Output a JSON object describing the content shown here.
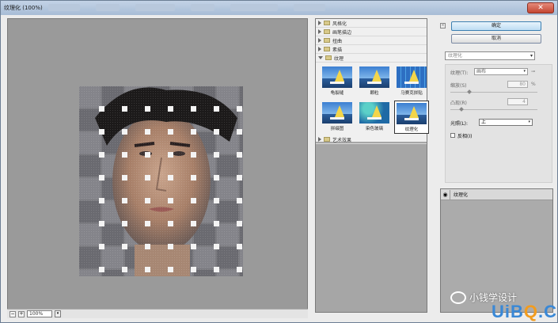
{
  "window": {
    "title": "纹理化 (100%)",
    "close_glyph": "✕"
  },
  "preview": {
    "zoom": "100%"
  },
  "gallery": {
    "folders_top": [
      "风格化",
      "画笔描边",
      "扭曲",
      "素描"
    ],
    "open_folder": "纹理",
    "thumbnails": [
      {
        "label": "龟裂缝",
        "selected": false,
        "style": "sail"
      },
      {
        "label": "颗粒",
        "selected": false,
        "style": "sail"
      },
      {
        "label": "马赛克拼贴",
        "selected": false,
        "style": "mosaic"
      },
      {
        "label": "拼缀图",
        "selected": false,
        "style": "sail"
      },
      {
        "label": "染色玻璃",
        "selected": false,
        "style": "stained"
      },
      {
        "label": "纹理化",
        "selected": true,
        "style": "sail"
      }
    ],
    "folder_bottom": "艺术效果"
  },
  "controls": {
    "ok_label": "确定",
    "cancel_label": "取消",
    "filter_select": "纹理化",
    "texture_label": "纹理(T):",
    "texture_value": "画布",
    "scaling_label": "缩放(S)",
    "scaling_value": "80",
    "scaling_unit": "%",
    "relief_label": "凸现(R)",
    "relief_value": "4",
    "light_label": "光照(L):",
    "light_value": "上",
    "invert_label": "反相(I)"
  },
  "layers": {
    "items": [
      {
        "name": "纹理化",
        "visible": true
      }
    ]
  },
  "watermark": {
    "text": "小钱学设计",
    "brand_u": "U",
    "brand_i": "i",
    "brand_b": "B",
    "brand_q": "Q",
    "brand_dot": ".",
    "brand_com": "CoM"
  }
}
